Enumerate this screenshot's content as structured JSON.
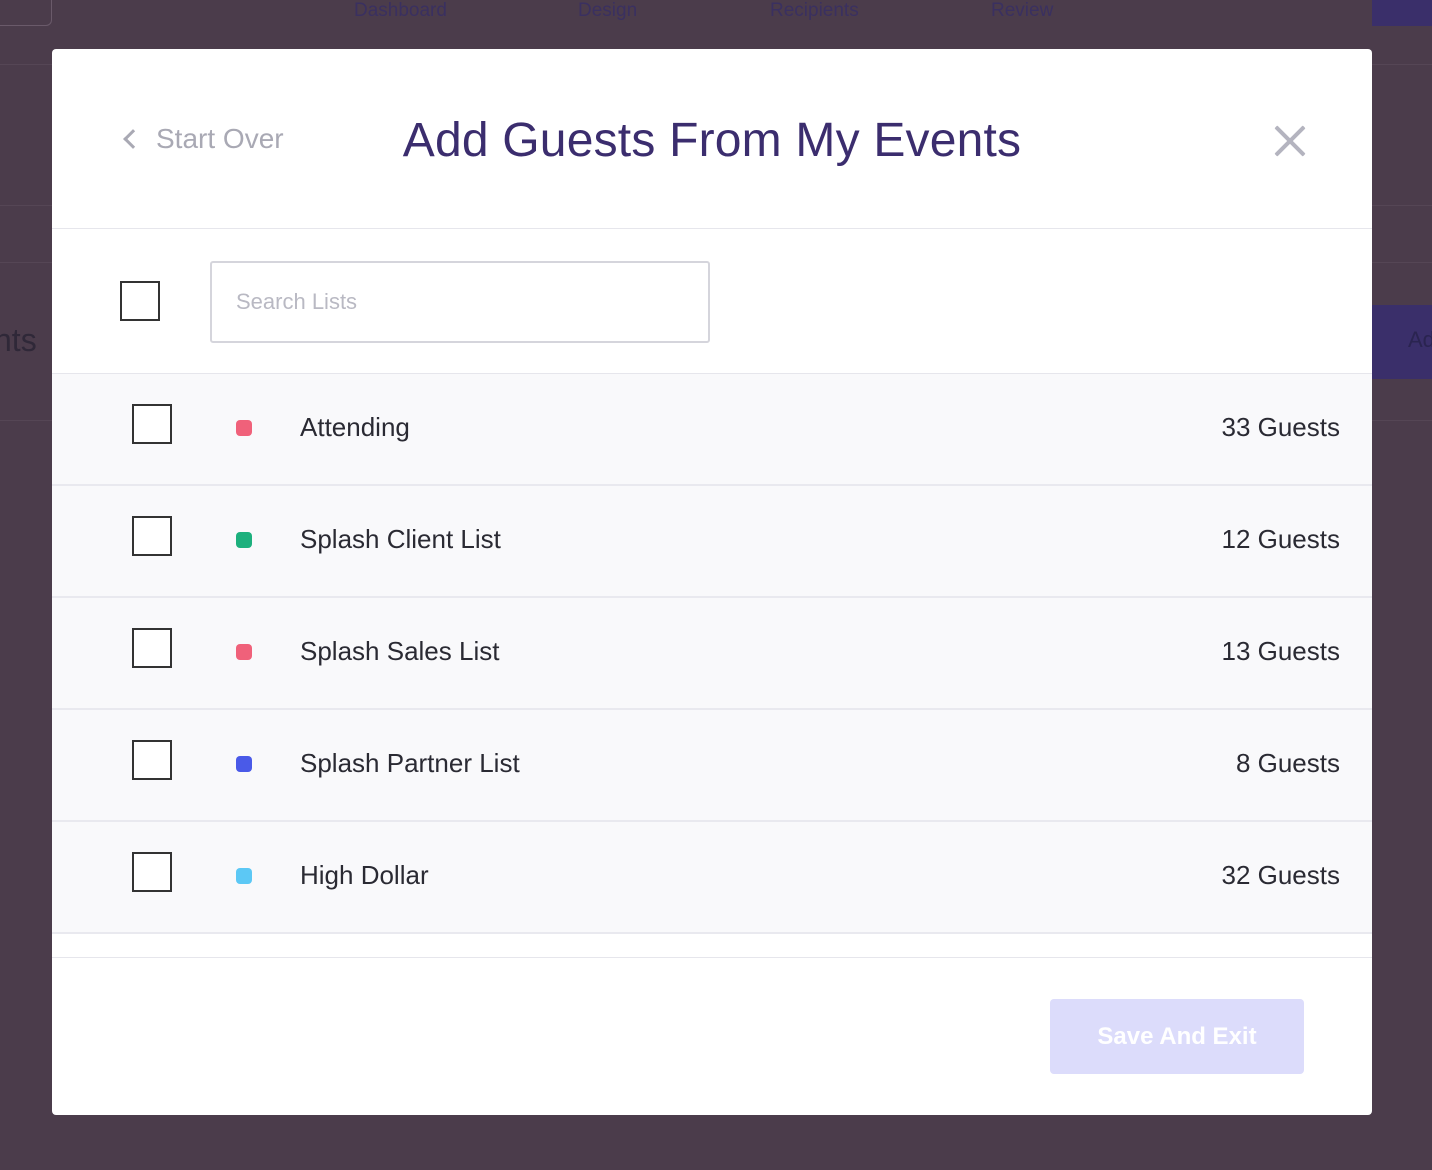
{
  "background": {
    "steps": [
      "Dashboard",
      "Design",
      "Recipients",
      "Review"
    ],
    "side_text": "nts",
    "right_button_text": "Ad"
  },
  "modal": {
    "start_over": "Start Over",
    "title": "Add Guests From My Events",
    "search_placeholder": "Search Lists",
    "save_label": "Save And Exit"
  },
  "lists": [
    {
      "name": "Attending",
      "count": "33 Guests",
      "color": "#f0617a"
    },
    {
      "name": "Splash Client List",
      "count": "12 Guests",
      "color": "#1db07d"
    },
    {
      "name": "Splash Sales List",
      "count": "13 Guests",
      "color": "#f0617a"
    },
    {
      "name": "Splash Partner List",
      "count": "8 Guests",
      "color": "#4a5ae8"
    },
    {
      "name": "High Dollar",
      "count": "32 Guests",
      "color": "#5cc8f5"
    }
  ]
}
